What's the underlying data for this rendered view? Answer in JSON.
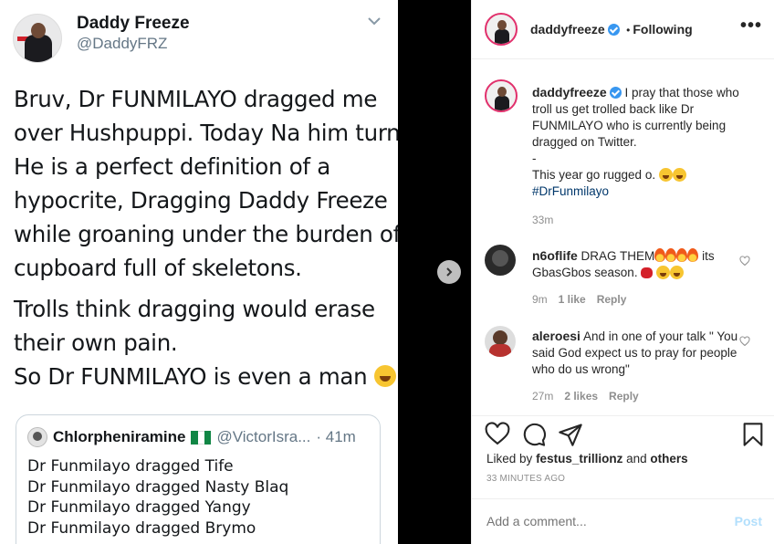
{
  "tweet": {
    "name": "Daddy Freeze",
    "handle": "@DaddyFRZ",
    "para1": [
      "Bruv, Dr FUNMILAYO dragged me",
      "over Hushpuppi. Today Na him turn.",
      "He is a perfect definition of a",
      "hypocrite, Dragging Daddy Freeze",
      "while groaning under the burden of a",
      "cupboard full of skeletons."
    ],
    "para2": [
      "Trolls think dragging would erase",
      "their own pain."
    ],
    "para3": "So Dr FUNMILAYO is even a man",
    "quote": {
      "name": "Chlorpheniramine",
      "handle": "@VictorIsra...",
      "time": "· 41m",
      "lines": [
        "Dr Funmilayo dragged Tife",
        "Dr Funmilayo dragged Nasty Blaq",
        "Dr Funmilayo dragged Yangy",
        "Dr Funmilayo dragged Brymo"
      ]
    }
  },
  "post": {
    "username": "daddyfreeze",
    "follow_sep": "•",
    "follow_status": "Following",
    "more": "•••",
    "caption": {
      "username": "daddyfreeze",
      "text": "I pray that those who troll us get trolled back like Dr FUNMILAYO who is currently being dragged on Twitter.",
      "dash": "-",
      "line2": "This year go rugged o.",
      "hashtag": "#DrFunmilayo",
      "time": "33m"
    },
    "comments": [
      {
        "username": "n6oflife",
        "text_a": "DRAG THEM",
        "text_b": "its GbasGbos season.",
        "time": "9m",
        "likes": "1 like",
        "reply": "Reply"
      },
      {
        "username": "aleroesi",
        "text": "And in one of your talk \" You said God expect us to pray for people who do us wrong\"",
        "time": "27m",
        "likes": "2 likes",
        "reply": "Reply"
      }
    ],
    "liked_by_prefix": "Liked by",
    "liked_by_user": "festus_trillionz",
    "liked_by_and": "and",
    "liked_by_others": "others",
    "ago": "33 MINUTES AGO",
    "comment_placeholder": "Add a comment...",
    "post_label": "Post"
  },
  "colors": {
    "accent": "#3897f0",
    "post_disabled": "#b2dffc",
    "divider": "#000000"
  }
}
